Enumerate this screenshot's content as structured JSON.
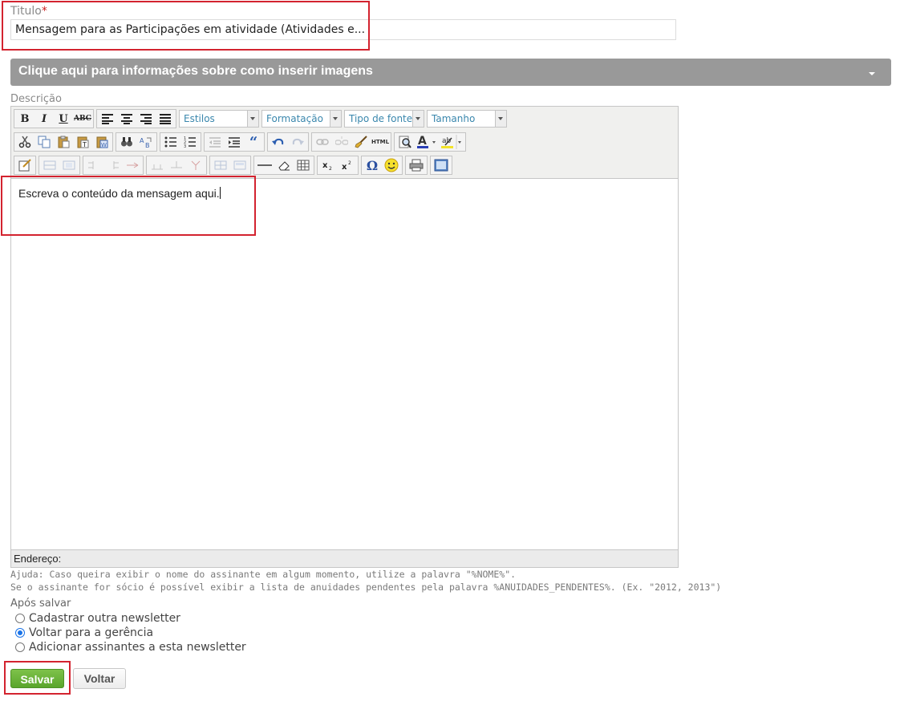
{
  "form": {
    "title_label": "Titulo",
    "required_mark": "*",
    "title_value": "Mensagem para as Participações em atividade (Atividades e...",
    "info_bar_label": "Clique aqui para informações sobre como inserir imagens",
    "description_label": "Descrição"
  },
  "toolbar": {
    "bold": "B",
    "italic": "I",
    "underline": "U",
    "strike": "ABC",
    "styles_combo": "Estilos",
    "format_combo": "Formatação",
    "font_combo": "Tipo de fonte",
    "size_combo": "Tamanho",
    "html_button": "HTML",
    "omega": "Ω"
  },
  "editor": {
    "content": "Escreva o conteúdo da mensagem aqui.",
    "path_label": "Endereço:"
  },
  "help": {
    "line1": "Ajuda: Caso queira exibir o nome do assinante em algum momento, utilize a palavra \"%NOME%\".",
    "line2": "Se o assinante for sócio é possível exibir a lista de anuidades pendentes pela palavra %ANUIDADES_PENDENTES%. (Ex. \"2012, 2013\")"
  },
  "after_save": {
    "label": "Após salvar",
    "options": [
      {
        "label": "Cadastrar outra newsletter",
        "selected": false
      },
      {
        "label": "Voltar para a gerência",
        "selected": true
      },
      {
        "label": "Adicionar assinantes a esta newsletter",
        "selected": false
      }
    ]
  },
  "buttons": {
    "save": "Salvar",
    "back": "Voltar"
  },
  "colors": {
    "highlight": "#d3232f",
    "save_green": "#5aa52c",
    "bar_gray": "#999999",
    "radio_blue": "#1a73e8"
  }
}
